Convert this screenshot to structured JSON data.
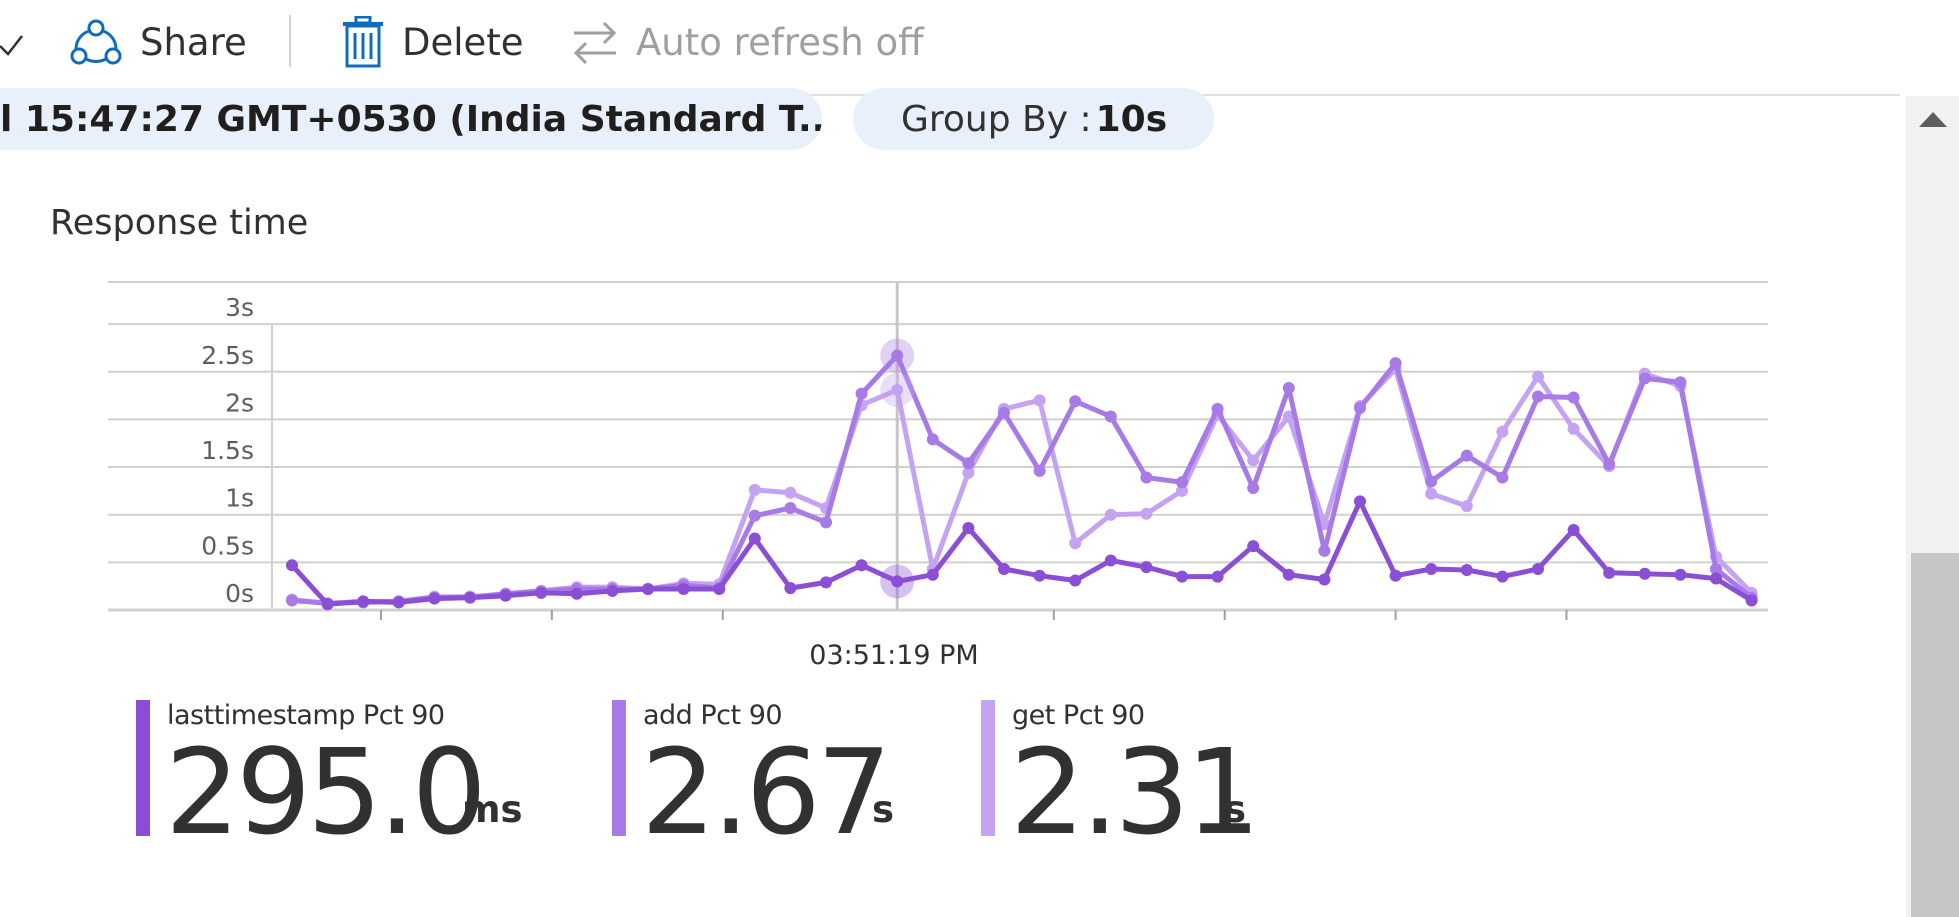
{
  "toolbar": {
    "share_label": "Share",
    "delete_label": "Delete",
    "auto_refresh_label": "Auto refresh off"
  },
  "filters": {
    "time_range": "l 15:47:27 GMT+0530 (India Standard T...",
    "group_by_label": "Group By :",
    "group_by_value": "10s"
  },
  "chart": {
    "title": "Response time",
    "x_tick_label": "03:51:19 PM"
  },
  "legend": [
    {
      "name": "lasttimestamp Pct 90",
      "value": "295.0",
      "unit": "ms",
      "color": "#8a4fd4"
    },
    {
      "name": "add Pct 90",
      "value": "2.67",
      "unit": "s",
      "color": "#a77ae6"
    },
    {
      "name": "get Pct 90",
      "value": "2.31",
      "unit": "s",
      "color": "#c4a3f2"
    }
  ],
  "chart_data": {
    "type": "line",
    "title": "Response time",
    "xlabel": "",
    "ylabel": "",
    "y_unit": "s",
    "y_ticks": [
      "0s",
      "0.5s",
      "1s",
      "1.5s",
      "2s",
      "2.5s",
      "3s"
    ],
    "ylim": [
      0,
      3
    ],
    "x_tick_labels": [
      "03:51:19 PM"
    ],
    "highlighted_index": 17,
    "grid": true,
    "series": [
      {
        "name": "lasttimestamp Pct 90",
        "color": "#8a4fd4",
        "values": [
          0.47,
          0.06,
          0.09,
          0.08,
          0.12,
          0.13,
          0.15,
          0.18,
          0.17,
          0.2,
          0.22,
          0.22,
          0.22,
          0.75,
          0.23,
          0.29,
          0.47,
          0.3,
          0.37,
          0.86,
          0.43,
          0.36,
          0.31,
          0.52,
          0.45,
          0.35,
          0.35,
          0.67,
          0.37,
          0.32,
          1.14,
          0.36,
          0.43,
          0.42,
          0.35,
          0.43,
          0.84,
          0.39,
          0.38,
          0.37,
          0.33,
          0.1
        ]
      },
      {
        "name": "add Pct 90",
        "color": "#a77ae6",
        "values": [
          0.1,
          0.07,
          0.08,
          0.09,
          0.13,
          0.13,
          0.17,
          0.2,
          0.22,
          0.22,
          0.22,
          0.26,
          0.23,
          0.99,
          1.07,
          0.92,
          2.27,
          2.67,
          1.79,
          1.54,
          2.07,
          1.46,
          2.19,
          2.03,
          1.39,
          1.34,
          2.11,
          1.28,
          2.33,
          0.62,
          2.12,
          2.59,
          1.35,
          1.62,
          1.39,
          2.24,
          2.23,
          1.53,
          2.43,
          2.39,
          0.43,
          0.13
        ]
      },
      {
        "name": "get Pct 90",
        "color": "#c4a3f2",
        "values": [
          0.11,
          0.07,
          0.09,
          0.09,
          0.14,
          0.14,
          0.17,
          0.2,
          0.24,
          0.24,
          0.22,
          0.28,
          0.27,
          1.26,
          1.23,
          1.07,
          2.15,
          2.31,
          0.43,
          1.44,
          2.11,
          2.2,
          0.7,
          1.0,
          1.01,
          1.25,
          2.05,
          1.57,
          2.03,
          0.9,
          2.14,
          2.53,
          1.22,
          1.09,
          1.87,
          2.45,
          1.9,
          1.51,
          2.48,
          2.35,
          0.56,
          0.18
        ]
      }
    ]
  }
}
